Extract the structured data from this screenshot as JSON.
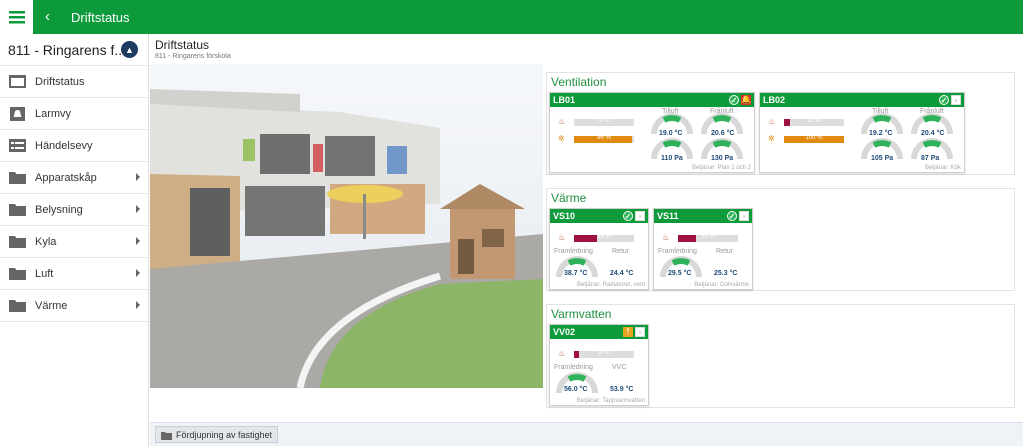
{
  "topbar": {
    "title": "Driftstatus",
    "back": "‹"
  },
  "sidebar": {
    "property": "811 - Ringarens f...",
    "items": [
      {
        "label": "Driftstatus",
        "icon": "dashboard-icon",
        "submenu": false
      },
      {
        "label": "Larmvy",
        "icon": "alarm-icon",
        "submenu": false
      },
      {
        "label": "Händelsevy",
        "icon": "list-icon",
        "submenu": false
      },
      {
        "label": "Apparatskåp",
        "icon": "folder-icon",
        "submenu": true
      },
      {
        "label": "Belysning",
        "icon": "folder-icon",
        "submenu": true
      },
      {
        "label": "Kyla",
        "icon": "folder-icon",
        "submenu": true
      },
      {
        "label": "Luft",
        "icon": "folder-icon",
        "submenu": true
      },
      {
        "label": "Värme",
        "icon": "folder-icon",
        "submenu": true
      }
    ]
  },
  "content": {
    "title": "Driftstatus",
    "subtitle": "811 - Ringarens förskola"
  },
  "ventilation": {
    "title": "Ventilation",
    "units": [
      {
        "name": "LB01",
        "status": [
          "ok",
          "alarm"
        ],
        "bar1": {
          "text": "0 %",
          "value": 0
        },
        "bar2": {
          "text": "96 %",
          "value": 96
        },
        "label1": "Tilluft",
        "label2": "Frånluft",
        "t1": "19.0 °C",
        "t2": "20.6 °C",
        "p1": "110 Pa",
        "p2": "130 Pa",
        "serves": "Betjänar: Plan 1 och 2"
      },
      {
        "name": "LB02",
        "status": [
          "ok",
          "gray"
        ],
        "bar1": {
          "text": "10 %",
          "value": 10
        },
        "bar2": {
          "text": "100 %",
          "value": 100
        },
        "label1": "Tilluft",
        "label2": "Frånluft",
        "t1": "19.2 °C",
        "t2": "20.4 °C",
        "p1": "105 Pa",
        "p2": "87 Pa",
        "serves": "Betjänar: Kök"
      }
    ]
  },
  "varme": {
    "title": "Värme",
    "units": [
      {
        "name": "VS10",
        "status": [
          "ok",
          "gray"
        ],
        "bar": {
          "text": "38 %",
          "value": 38
        },
        "label1": "Framledning",
        "label2": "Retur",
        "t1": "38.7 °C",
        "t2": "24.4 °C",
        "serves": "Betjänar: Radiatorer, vent"
      },
      {
        "name": "VS11",
        "status": [
          "ok",
          "gray"
        ],
        "bar": {
          "text": "30 %",
          "value": 30
        },
        "label1": "Framledning",
        "label2": "Retur",
        "t1": "29.5 °C",
        "t2": "25.3 °C",
        "serves": "Betjänar: Golvvärme"
      }
    ]
  },
  "varmvatten": {
    "title": "Varmvatten",
    "units": [
      {
        "name": "VV02",
        "status": [
          "warn",
          "gray"
        ],
        "bar": {
          "text": "8 %",
          "value": 8
        },
        "label1": "Framledning",
        "label2": "VVC",
        "t1": "56.0 °C",
        "t2": "53.9 °C",
        "serves": "Betjänar: Tappvarmvatten"
      }
    ]
  },
  "footer": {
    "button": "Fördjupning av fastighet"
  },
  "colors": {
    "brand": "#0c9a3a",
    "heat": "#a01040",
    "fan": "#e08a10",
    "gauge": "#2fb35a"
  }
}
